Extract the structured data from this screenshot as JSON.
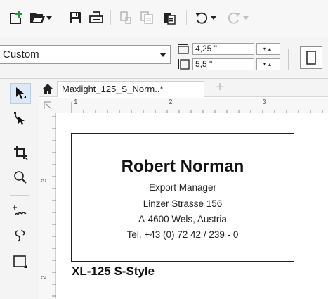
{
  "toolbar": {
    "icons": [
      "new-document-icon",
      "open-folder-icon",
      "dropdown-arrow-icon",
      "save-icon",
      "print-icon",
      "cut-icon",
      "copy-icon",
      "paste-icon",
      "undo-icon",
      "undo-dropdown-icon",
      "redo-icon",
      "redo-dropdown-icon"
    ]
  },
  "propbar": {
    "preset": "Custom",
    "width_value": "4,25 \"",
    "height_value": "5,5 \""
  },
  "tabs": {
    "document": "Maxlight_125_S_Norm..*"
  },
  "rulers": {
    "h_labels": [
      "1",
      "2",
      "3"
    ],
    "v_labels": [
      "3",
      "2"
    ]
  },
  "card": {
    "name": "Robert Norman",
    "title": "Export Manager",
    "street": "Linzer Strasse 156",
    "city": "A-4600 Wels, Austria",
    "phone": "Tel. +43 (0) 72 42 / 239 - 0"
  },
  "caption": "XL-125 S-Style"
}
